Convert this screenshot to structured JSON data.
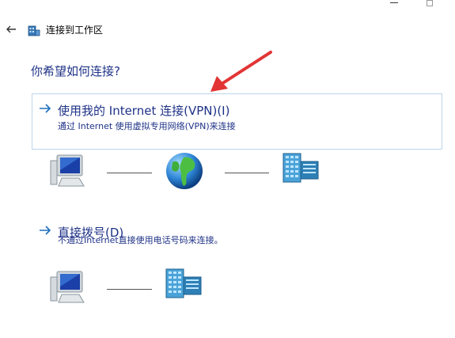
{
  "window": {
    "title": "连接到工作区"
  },
  "question": "你希望如何连接?",
  "options": [
    {
      "title": "使用我的 Internet 连接(VPN)(I)",
      "description": "通过 Internet 使用虚拟专用网络(VPN)来连接"
    },
    {
      "title": "直接拨号(D)",
      "description": "不通过Internet直接使用电话号码来连接。"
    }
  ],
  "icons": {
    "back": "back-arrow-icon",
    "window": "workplace-network-icon",
    "option_arrow": "right-arrow-icon",
    "computer": "computer-icon",
    "globe": "globe-icon",
    "server": "server-building-icon",
    "annotation": "red-arrow-annotation"
  },
  "colors": {
    "accent_text": "#1e3287",
    "selection_border": "#b9d6ee",
    "annotation": "#e23434"
  }
}
